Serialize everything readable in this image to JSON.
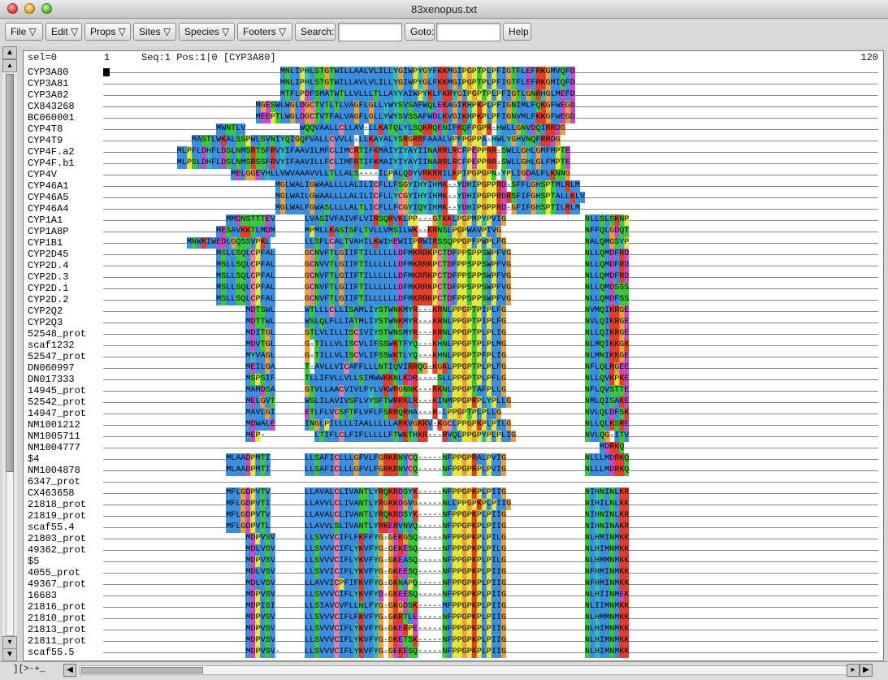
{
  "window": {
    "title": "83xenopus.txt"
  },
  "toolbar": {
    "file": "File ▽",
    "edit": "Edit ▽",
    "props": "Props ▽",
    "sites": "Sites ▽",
    "species": "Species ▽",
    "footers": "Footers ▽",
    "search_label": "Search:",
    "search_value": "",
    "goto_label": "Goto:",
    "goto_value": "",
    "help": "Help"
  },
  "header": {
    "sel": "sel=0",
    "start": "1",
    "pos": "Seq:1 Pos:1|0 [CYP3A80]",
    "end": "120"
  },
  "footer": {
    "coords": "][>-+_"
  },
  "colors": {
    "A": "#3c8ede",
    "G": "#e8a33c",
    "L": "#3c8ede",
    "I": "#3c8ede",
    "V": "#3c8ede",
    "M": "#3c8ede",
    "F": "#3c8ede",
    "W": "#3c8ede",
    "P": "#e6e63c",
    "C": "#ef7fa0",
    "S": "#3cc83c",
    "T": "#3cc83c",
    "N": "#3cc83c",
    "Q": "#3cc83c",
    "D": "#c84cc8",
    "E": "#c84cc8",
    "K": "#e33c2c",
    "R": "#e33c2c",
    "H": "#33bbbb",
    "Y": "#33bbbb",
    "X": "#999999"
  },
  "sequences": [
    {
      "name": "CYP3A80",
      "segs": [
        {
          "s": 36,
          "t": "MNLIPHLSTGTWILLAALVLILLYGIWPYGYFKKMGIPGPTPLPFIGTFLEFRKGMVQFD"
        }
      ]
    },
    {
      "name": "CYP3A81",
      "segs": [
        {
          "s": 36,
          "t": "MNLIPHLSTGTWILLAVLVLILLYGIWPYGLFKKMGIPGPTPLPFIGTFLEFRKGMIQFD"
        }
      ]
    },
    {
      "name": "CYP3A82",
      "segs": [
        {
          "s": 36,
          "t": "MTFLPDFSMATWTLLVLLLTLLAYYAIWPYKLFKRYGIPGPTPLPFIGTLGNRHGLMEFD"
        }
      ]
    },
    {
      "name": "CX843268",
      "segs": [
        {
          "s": 31,
          "t": "MGESWLWGLDGCTVTLTLVAGFLGLLYWYSVSAFWQLEKAGIKHPKPLPFIGNIMLFQKGFWEGD"
        }
      ]
    },
    {
      "name": "BC060001",
      "segs": [
        {
          "s": 31,
          "t": "MEEPTLWGLDGCTVTFALVAGFLGLLYWYSVSSAFWDLKVGIKHPKPLPFIGNVMLFKKGFWEGD"
        }
      ]
    },
    {
      "name": "CYP4T8",
      "segs": [
        {
          "s": 23,
          "t": "MWNTLV"
        },
        {
          "s": 40,
          "t": "WQQVAALLCLLAV-LLKATQLYLSQKRQENIFKQFPGPR-HWLLGNVDQIRRDG"
        }
      ]
    },
    {
      "name": "CYP4T9",
      "segs": [
        {
          "s": 18,
          "t": "MASTLWKALSSPWLSVNIYQIGQFVALLCVVLL-LLKAYALYSRGRRFAAALVPFPGPPA-HWLYGHVNQFRRDG"
        }
      ]
    },
    {
      "name": "CYP4F.a2",
      "segs": [
        {
          "s": 15,
          "t": "MLPFLDHFLDSLNMSRTSFRVYIFAAVILMFCLIMCRTIFKMAIYIYAYIINARRLRCFPEPPRR-SWLLGHLGMFMPTE"
        }
      ]
    },
    {
      "name": "CYP4F.b1",
      "segs": [
        {
          "s": 15,
          "t": "MLPSLDHFLDSLNMSRSSFRVYIFAAVILLFCLIMFRTIFKMAIYIYAYIINARRLRCFPEPPRR-SWLLGHLGLFMPTE"
        }
      ]
    },
    {
      "name": "CYP4V",
      "segs": [
        {
          "s": 26,
          "t": "MELGGEVHLLVWVAAAVVLLTLLALS----ILPALQDYVRKRRILKPIPGPGPN-YPLIGDALFLKNNG"
        }
      ]
    },
    {
      "name": "CYP46A1",
      "segs": [
        {
          "s": 35,
          "t": "MGLWALIGWAALLLLALILICFLLFSGYIHYIHMK--YDHIPGPPRD-SFFLGHSPTMLRLM"
        }
      ]
    },
    {
      "name": "CYP46A5",
      "segs": [
        {
          "s": 35,
          "t": "MGLWAILGWAALLLLALILICFLLYCGYIHYIHMK--YDHIPGPPRDRSFIFGHSPTALLKLV"
        }
      ]
    },
    {
      "name": "CYP46A4",
      "segs": [
        {
          "s": 35,
          "t": "MGLWALFGWASLLLLALTLICFLLFCGYIQYIHMK--YDHIPGPPRD-GFIFGHSPTILRLM"
        }
      ]
    },
    {
      "name": "CYP1A1",
      "segs": [
        {
          "s": 25,
          "t": "MMDNSTTTEV"
        },
        {
          "s": 41,
          "t": "LVASIVFAIVFLVIRSQRVKLPP---GTKKLPGPMPYPVIG"
        },
        {
          "s": 98,
          "t": "NLLSLSKNP"
        }
      ]
    },
    {
      "name": "CYP1A8P",
      "segs": [
        {
          "s": 23,
          "t": "MESAVKKTLMDM"
        },
        {
          "s": 41,
          "t": "MPMLLKASISFLTVLLVMSILWK--KRNSLPGPWAVPIVG"
        },
        {
          "s": 98,
          "t": "NFFQLGDQT"
        }
      ]
    },
    {
      "name": "CYP1B1",
      "segs": [
        {
          "s": 17,
          "t": "MNWKIWEDLGQSSVPKL"
        },
        {
          "s": 41,
          "t": "LLSFLCALTVAHILKWIHEWIIPRWIRSSQPPGPFPWPLFG"
        },
        {
          "s": 98,
          "t": "NALQMGSYP"
        }
      ]
    },
    {
      "name": "CYP2D45",
      "segs": [
        {
          "s": 23,
          "t": "MSLLSQLCPFAL"
        },
        {
          "s": 41,
          "t": "GCNVFTLGIIFTILLLLLLDFMKRRKPCTDFPPSPPSWPFVG"
        },
        {
          "s": 98,
          "t": "NLLQMDFRD"
        }
      ]
    },
    {
      "name": "CYP2D.4",
      "segs": [
        {
          "s": 23,
          "t": "MSLLSQLCPFAL"
        },
        {
          "s": 41,
          "t": "GCNVVTLGIIFTILLLLLLDFMKRRKPCTDFPPSPPSWPFVG"
        },
        {
          "s": 98,
          "t": "NLLQMDFRD"
        }
      ]
    },
    {
      "name": "CYP2D.3",
      "segs": [
        {
          "s": 23,
          "t": "MSLLSQLCPFAL"
        },
        {
          "s": 41,
          "t": "GCNVFTLGIIFTILLLLLLDFMKRRKPCTDFPPSPPSWPFVG"
        },
        {
          "s": 98,
          "t": "NLLQMDFRD"
        }
      ]
    },
    {
      "name": "CYP2D.1",
      "segs": [
        {
          "s": 23,
          "t": "MSLLSQLCPFAL"
        },
        {
          "s": 41,
          "t": "GCNVFTLGIIFTILLLLLLDFMKRRKPCTDFPPSPPSWPFVG"
        },
        {
          "s": 98,
          "t": "NLLQMDSSS"
        }
      ]
    },
    {
      "name": "CYP2D.2",
      "segs": [
        {
          "s": 23,
          "t": "MSLLSQLCPFAL"
        },
        {
          "s": 41,
          "t": "GCNVFTLGIIFTILLLLLLDFMKRRKPCTDFPPSPPSWPFVG"
        },
        {
          "s": 98,
          "t": "NLLQMDFSS"
        }
      ]
    },
    {
      "name": "CYP2Q2",
      "segs": [
        {
          "s": 29,
          "t": "MDTSWL"
        },
        {
          "s": 41,
          "t": "WTLLLCLLISAMLIYSTWNKMYR---KRNLPPGPTPIPLFG"
        },
        {
          "s": 98,
          "t": "NVMQIKRGE"
        }
      ]
    },
    {
      "name": "CYP2Q3",
      "segs": [
        {
          "s": 29,
          "t": "MDTTWL"
        },
        {
          "s": 41,
          "t": "WSLQLFLLIATMLIYSTWNKMYR---KRNLPPGPTPIPLFG"
        },
        {
          "s": 98,
          "t": "NVLQIKRGE"
        }
      ]
    },
    {
      "name": "52548_prot",
      "segs": [
        {
          "s": 29,
          "t": "MDITGL"
        },
        {
          "s": 41,
          "t": "GTLVLILLISCIVIYSTWNSMYR---KRNLPPGPTPLPLIG"
        },
        {
          "s": 98,
          "t": "NLLQIKRGE"
        }
      ]
    },
    {
      "name": "scaf1232",
      "segs": [
        {
          "s": 29,
          "t": "MDVTGL"
        },
        {
          "s": 41,
          "t": "G-TILLVLISCVLIFSSWKTFYQ---KHNLPPGPTPLPLMG"
        },
        {
          "s": 98,
          "t": "NLMQIKKGK"
        }
      ]
    },
    {
      "name": "52547_prot",
      "segs": [
        {
          "s": 29,
          "t": "MYVAGL"
        },
        {
          "s": 41,
          "t": "G-TILLVLISCVLIFSSWKTLYQ---KHNLPPGPTPFPLIG"
        },
        {
          "s": 98,
          "t": "NLMNIKKGE"
        }
      ]
    },
    {
      "name": "DN060997",
      "segs": [
        {
          "s": 29,
          "t": "MEILGA"
        },
        {
          "s": 41,
          "t": "T-AVLLVICAFFLLLNTIQVIRRQG-KGKLPPGPTPLPLFG"
        },
        {
          "s": 98,
          "t": "NFLQLRGEE"
        }
      ]
    },
    {
      "name": "DN017333",
      "segs": [
        {
          "s": 29,
          "t": "MSPSIF"
        },
        {
          "s": 41,
          "t": "TLLIFVLLVLLSIMWWKKNLKDR----SLLPPGPTPLPFLG"
        },
        {
          "s": 98,
          "t": "NLLQVKPKE"
        }
      ]
    },
    {
      "name": "14945_prot",
      "segs": [
        {
          "s": 29,
          "t": "MAMDSA"
        },
        {
          "s": 41,
          "t": "GTVLLAACVIVLFYLVKWRGNNK---RKNLPPGPTAFPLLG"
        },
        {
          "s": 98,
          "t": "NFLQVSTTE"
        }
      ]
    },
    {
      "name": "52542_prot",
      "segs": [
        {
          "s": 29,
          "t": "MELGVT"
        },
        {
          "s": 41,
          "t": "WSLILAVIVSFLVYSFTWRRKLR---KINMPPGPRPLYPLLG"
        },
        {
          "s": 98,
          "t": "NMLQISAKE"
        }
      ]
    },
    {
      "name": "14947_prot",
      "segs": [
        {
          "s": 29,
          "t": "MAVLGI"
        },
        {
          "s": 41,
          "t": "ETLFLVCSFTFLVFLFSRRQRHA---R-LPPGPTPLPLLG"
        },
        {
          "s": 98,
          "t": "NVLQLDFSK"
        }
      ]
    },
    {
      "name": "NM1001212",
      "segs": [
        {
          "s": 29,
          "t": "MDWALE"
        },
        {
          "s": 41,
          "t": "INGLPILLLLIAALLLLLARKVGKKV-KGCLPPGPKPLPILG"
        },
        {
          "s": 98,
          "t": "NLLQLKSRE"
        }
      ]
    },
    {
      "name": "NM1005711",
      "segs": [
        {
          "s": 29,
          "t": "MEP-"
        },
        {
          "s": 43,
          "t": "LTIFLCLFIFLLLLLFTWKTHKR---RVQLPPGPYPLPLIG"
        },
        {
          "s": 98,
          "t": "NVLQG-ITV"
        }
      ]
    },
    {
      "name": "NM1004777",
      "segs": [
        {
          "s": 101,
          "t": "MDRKQ"
        }
      ]
    },
    {
      "name": "$4",
      "segs": [
        {
          "s": 25,
          "t": "MLAADPMTI"
        },
        {
          "s": 41,
          "t": "LLSAFICLLLGFVLFGRKRNVCQ-----NFPPGPRALPVIG"
        },
        {
          "s": 98,
          "t": "NLLLMDRKQ"
        }
      ]
    },
    {
      "name": "NM1004878",
      "segs": [
        {
          "s": 25,
          "t": "MLAADPMTI"
        },
        {
          "s": 41,
          "t": "LLSAFICLLLGFVLFGRKRNVCQ-----NFPPGPRPLPVIG"
        },
        {
          "s": 98,
          "t": "NLLLMDRKQ"
        }
      ]
    },
    {
      "name": "6347_prot",
      "segs": []
    },
    {
      "name": "CX463658",
      "segs": [
        {
          "s": 25,
          "t": "MFLGDPVTV"
        },
        {
          "s": 41,
          "t": "LLAVALCLIVANTLYRQKRDSYK-----NFPPGPKPLPIIG"
        },
        {
          "s": 98,
          "t": "NIHNINLKR"
        }
      ]
    },
    {
      "name": "21818_prot",
      "segs": [
        {
          "s": 25,
          "t": "MFLGDPVTI"
        },
        {
          "s": 41,
          "t": "LLAVVLCLIVANTLYRGKKDGVG-----NLLPPGPKPLPIIG"
        },
        {
          "s": 98,
          "t": "NIHILNLKK"
        }
      ]
    },
    {
      "name": "21819_prot",
      "segs": [
        {
          "s": 25,
          "t": "MFLGDPVTV"
        },
        {
          "s": 41,
          "t": "LLAVALCLIVANTLYRQKRDSYK-----NFPPGPKPLPIIG"
        },
        {
          "s": 98,
          "t": "NIHNINLKR"
        }
      ]
    },
    {
      "name": "scaf55.4",
      "segs": [
        {
          "s": 25,
          "t": "MFLGDPVTL"
        },
        {
          "s": 41,
          "t": "LLAVVLSLIVANTLYRKERVNVQ-----NFPPGPKPLPIIG"
        },
        {
          "s": 98,
          "t": "NIHNINAKR"
        }
      ]
    },
    {
      "name": "21803_prot",
      "segs": [
        {
          "s": 29,
          "t": "MDPVSV"
        },
        {
          "s": 41,
          "t": "LLSVVVCIFLFKFFYG-GEKGSQ-----NFPPGPKPLPILG"
        },
        {
          "s": 98,
          "t": "NLHMINMKK"
        }
      ]
    },
    {
      "name": "49362_prot",
      "segs": [
        {
          "s": 29,
          "t": "MDLVSV"
        },
        {
          "s": 41,
          "t": "LLSVVVCIFLYKVFYG-GEKESQ-----NFPPGPKPLPILG"
        },
        {
          "s": 98,
          "t": "NLHIMNMKK"
        }
      ]
    },
    {
      "name": "$5",
      "segs": [
        {
          "s": 29,
          "t": "MDPVSV"
        },
        {
          "s": 41,
          "t": "LLSVVVCIFLYKVFYG-GKEASQ-----NFPPGPKPLPILG"
        },
        {
          "s": 98,
          "t": "NLHMMNMKK"
        }
      ]
    },
    {
      "name": "4055_prot",
      "segs": [
        {
          "s": 29,
          "t": "MDLVSV"
        },
        {
          "s": 41,
          "t": "LLSVVICIFLYKVFYG-GKEESQ-----NFPPGPKPLPIIG"
        },
        {
          "s": 98,
          "t": "NFHMINMKK"
        }
      ]
    },
    {
      "name": "49367_prot",
      "segs": [
        {
          "s": 29,
          "t": "MDLVSV"
        },
        {
          "s": 41,
          "t": "LLAVVICPFIFKVFYG-GKNAPQ-----NFPPGPKPLPIIG"
        },
        {
          "s": 98,
          "t": "NFHMINMKK"
        }
      ]
    },
    {
      "name": "16683",
      "segs": [
        {
          "s": 29,
          "t": "MDPVSV"
        },
        {
          "s": 41,
          "t": "LLSVVVCIFLYKVFYD-GKEESQ-----NFPPGPKPLPIIG"
        },
        {
          "s": 98,
          "t": "NLHIINMEK"
        }
      ]
    },
    {
      "name": "21816_prot",
      "segs": [
        {
          "s": 29,
          "t": "MDPISI"
        },
        {
          "s": 41,
          "t": "LLSIAVCVFLLNLFYG-GKGDSK-----MFPPGPKPLPIIG"
        },
        {
          "s": 98,
          "t": "NLIIMNMKK"
        }
      ]
    },
    {
      "name": "21810_prot",
      "segs": [
        {
          "s": 29,
          "t": "MDPVSV"
        },
        {
          "s": 41,
          "t": "LLSVVVCIFLFKVFYG-GKRTLE-----NFPPGPKPLPIIG"
        },
        {
          "s": 98,
          "t": "NLHMMNMKK"
        }
      ]
    },
    {
      "name": "21813_prot",
      "segs": [
        {
          "s": 29,
          "t": "MDPVSV"
        },
        {
          "s": 41,
          "t": "LLSVVVCIFLYKVFYG-GKERPE-----NFPPGPKPLPIIG"
        },
        {
          "s": 98,
          "t": "NLHIMNMKK"
        }
      ]
    },
    {
      "name": "21811_prot",
      "segs": [
        {
          "s": 29,
          "t": "MDPVSV"
        },
        {
          "s": 41,
          "t": "LLSVVVCIFLYKVFYG-GKETSK-----NFPPGPKPLPIIG"
        },
        {
          "s": 98,
          "t": "NLHIMNMKK"
        }
      ]
    },
    {
      "name": "scaf55.5",
      "segs": [
        {
          "s": 29,
          "t": "MDPVSV-"
        },
        {
          "s": 41,
          "t": "LLSVVVCIFLYKVFYG-GEKESQ-----NFPPGPKPLPIIG"
        },
        {
          "s": 98,
          "t": "NLHIMNMKK"
        }
      ]
    }
  ]
}
